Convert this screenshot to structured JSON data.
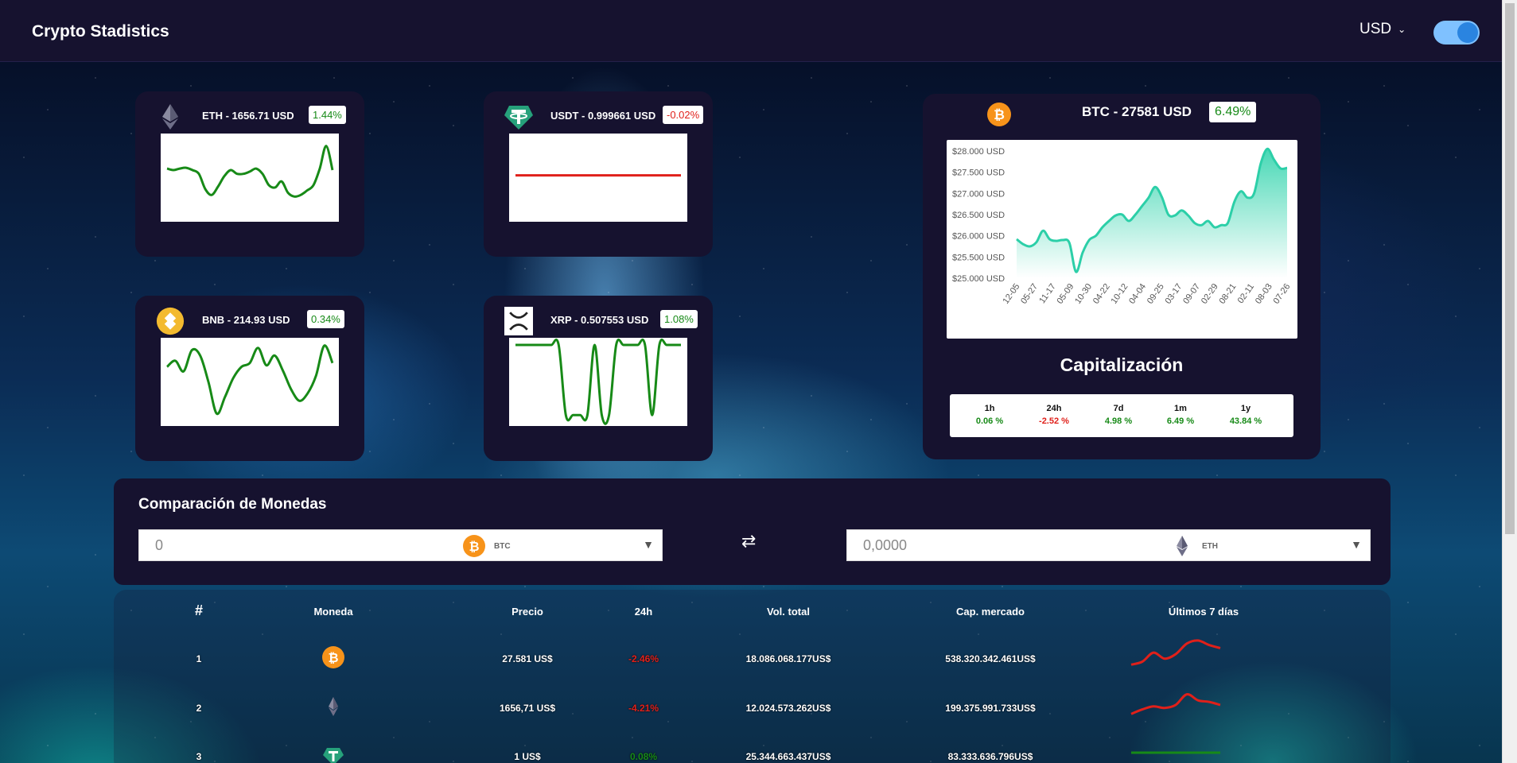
{
  "header": {
    "brand": "Crypto Stadistics",
    "currency": "USD"
  },
  "mini_cards": [
    {
      "id": "eth",
      "label": "ETH - 1656.71 USD",
      "change": "1.44%",
      "direction": "up",
      "icon": "ethereum-icon",
      "series": [
        0.62,
        0.6,
        0.62,
        0.63,
        0.6,
        0.55,
        0.35,
        0.27,
        0.38,
        0.52,
        0.6,
        0.55,
        0.55,
        0.58,
        0.62,
        0.55,
        0.4,
        0.37,
        0.45,
        0.3,
        0.25,
        0.27,
        0.33,
        0.4,
        0.62,
        0.92,
        0.6
      ]
    },
    {
      "id": "usdt",
      "label": "USDT - 0.999661 USD",
      "change": "-0.02%",
      "direction": "down",
      "icon": "tether-icon",
      "series": [
        0.53,
        0.53,
        0.53,
        0.53,
        0.53,
        0.53,
        0.53,
        0.53,
        0.53,
        0.53,
        0.53,
        0.53,
        0.53,
        0.53,
        0.53
      ]
    },
    {
      "id": "bnb",
      "label": "BNB - 214.93 USD",
      "change": "0.34%",
      "direction": "up",
      "icon": "binance-icon",
      "series": [
        0.7,
        0.78,
        0.64,
        0.92,
        0.85,
        0.5,
        0.08,
        0.3,
        0.55,
        0.7,
        0.75,
        0.95,
        0.72,
        0.85,
        0.65,
        0.4,
        0.25,
        0.35,
        0.58,
        0.98,
        0.75
      ]
    },
    {
      "id": "xrp",
      "label": "XRP - 0.507553 USD",
      "change": "1.08%",
      "direction": "up",
      "icon": "xrp-icon",
      "series": [
        0.99,
        0.99,
        0.99,
        0.99,
        0.99,
        0.99,
        0.99,
        0.06,
        0.06,
        0.06,
        0.06,
        0.99,
        0.06,
        0.06,
        0.99,
        0.99,
        0.99,
        0.99,
        0.99,
        0.06,
        0.99,
        0.99,
        0.99,
        0.99
      ]
    }
  ],
  "btc": {
    "title": "BTC - 27581 USD",
    "change": "6.49%",
    "icon": "bitcoin-icon"
  },
  "chart_data": {
    "type": "area",
    "series": [
      {
        "values": [
          25920,
          25800,
          25750,
          25850,
          26120,
          25920,
          25880,
          25900,
          25830,
          25150,
          25600,
          25900,
          26000,
          26200,
          26350,
          26480,
          26500,
          26350,
          26500,
          26700,
          26900,
          27150,
          26920,
          26500,
          26480,
          26600,
          26480,
          26300,
          26250,
          26350,
          26200,
          26250,
          26300,
          26800,
          27050,
          26900,
          27000,
          27700,
          28050,
          27800,
          27590,
          27600
        ]
      }
    ],
    "x_tick_labels": [
      "12-05",
      "05-27",
      "11-17",
      "05-09",
      "10-30",
      "04-22",
      "10-12",
      "04-04",
      "09-25",
      "03-17",
      "09-07",
      "02-29",
      "08-21",
      "02-11",
      "08-03",
      "07-26"
    ],
    "y_tick_labels": [
      "$28.000 USD",
      "$27.500 USD",
      "$27.000 USD",
      "$26.500 USD",
      "$26.000 USD",
      "$25.500 USD",
      "$25.000 USD"
    ],
    "ylim": [
      25000,
      28000
    ],
    "colors": {
      "line": "#2ccfa8",
      "fill_top": "#3dd6b1",
      "fill_bottom": "#ffffff"
    }
  },
  "capitalization": {
    "title": "Capitalización",
    "periods": [
      {
        "label": "1h",
        "value": "0.06 %",
        "direction": "up"
      },
      {
        "label": "24h",
        "value": "-2.52 %",
        "direction": "down"
      },
      {
        "label": "7d",
        "value": "4.98 %",
        "direction": "up"
      },
      {
        "label": "1m",
        "value": "6.49 %",
        "direction": "up"
      },
      {
        "label": "1y",
        "value": "43.84 %",
        "direction": "up"
      }
    ]
  },
  "compare": {
    "title": "Comparación de Monedas",
    "from_value": "0",
    "from_coin": "BTC",
    "to_value": "0,0000",
    "to_coin": "ETH",
    "swap_symbol": "⇄"
  },
  "table": {
    "headers": [
      "#",
      "Moneda",
      "Precio",
      "24h",
      "Vol. total",
      "Cap. mercado",
      "Últimos 7 días"
    ],
    "rows": [
      {
        "rank": "1",
        "coin_icon": "bitcoin-icon",
        "price": "27.581 US$",
        "change": "-2.46%",
        "direction": "down",
        "volume": "18.086.068.177US$",
        "market_cap": "538.320.342.461US$",
        "trend": [
          0.15,
          0.25,
          0.55,
          0.35,
          0.5,
          0.85,
          0.95,
          0.8,
          0.7
        ]
      },
      {
        "rank": "2",
        "coin_icon": "ethereum-icon",
        "price": "1656,71 US$",
        "change": "-4.21%",
        "direction": "down",
        "volume": "12.024.573.262US$",
        "market_cap": "199.375.991.733US$",
        "trend": [
          0.15,
          0.3,
          0.4,
          0.35,
          0.45,
          0.8,
          0.6,
          0.55,
          0.45
        ]
      },
      {
        "rank": "3",
        "coin_icon": "tether-icon",
        "price": "1 US$",
        "change": "0.08%",
        "direction": "up",
        "volume": "25.344.663.437US$",
        "market_cap": "83.333.636.796US$",
        "trend": [
          0.5,
          0.5,
          0.5,
          0.5,
          0.5,
          0.5,
          0.5,
          0.5,
          0.5
        ]
      }
    ]
  },
  "colors": {
    "positive": "#178a17",
    "negative": "#e0201a",
    "card_bg": "#16122f",
    "accent_btc": "#f7931a"
  }
}
